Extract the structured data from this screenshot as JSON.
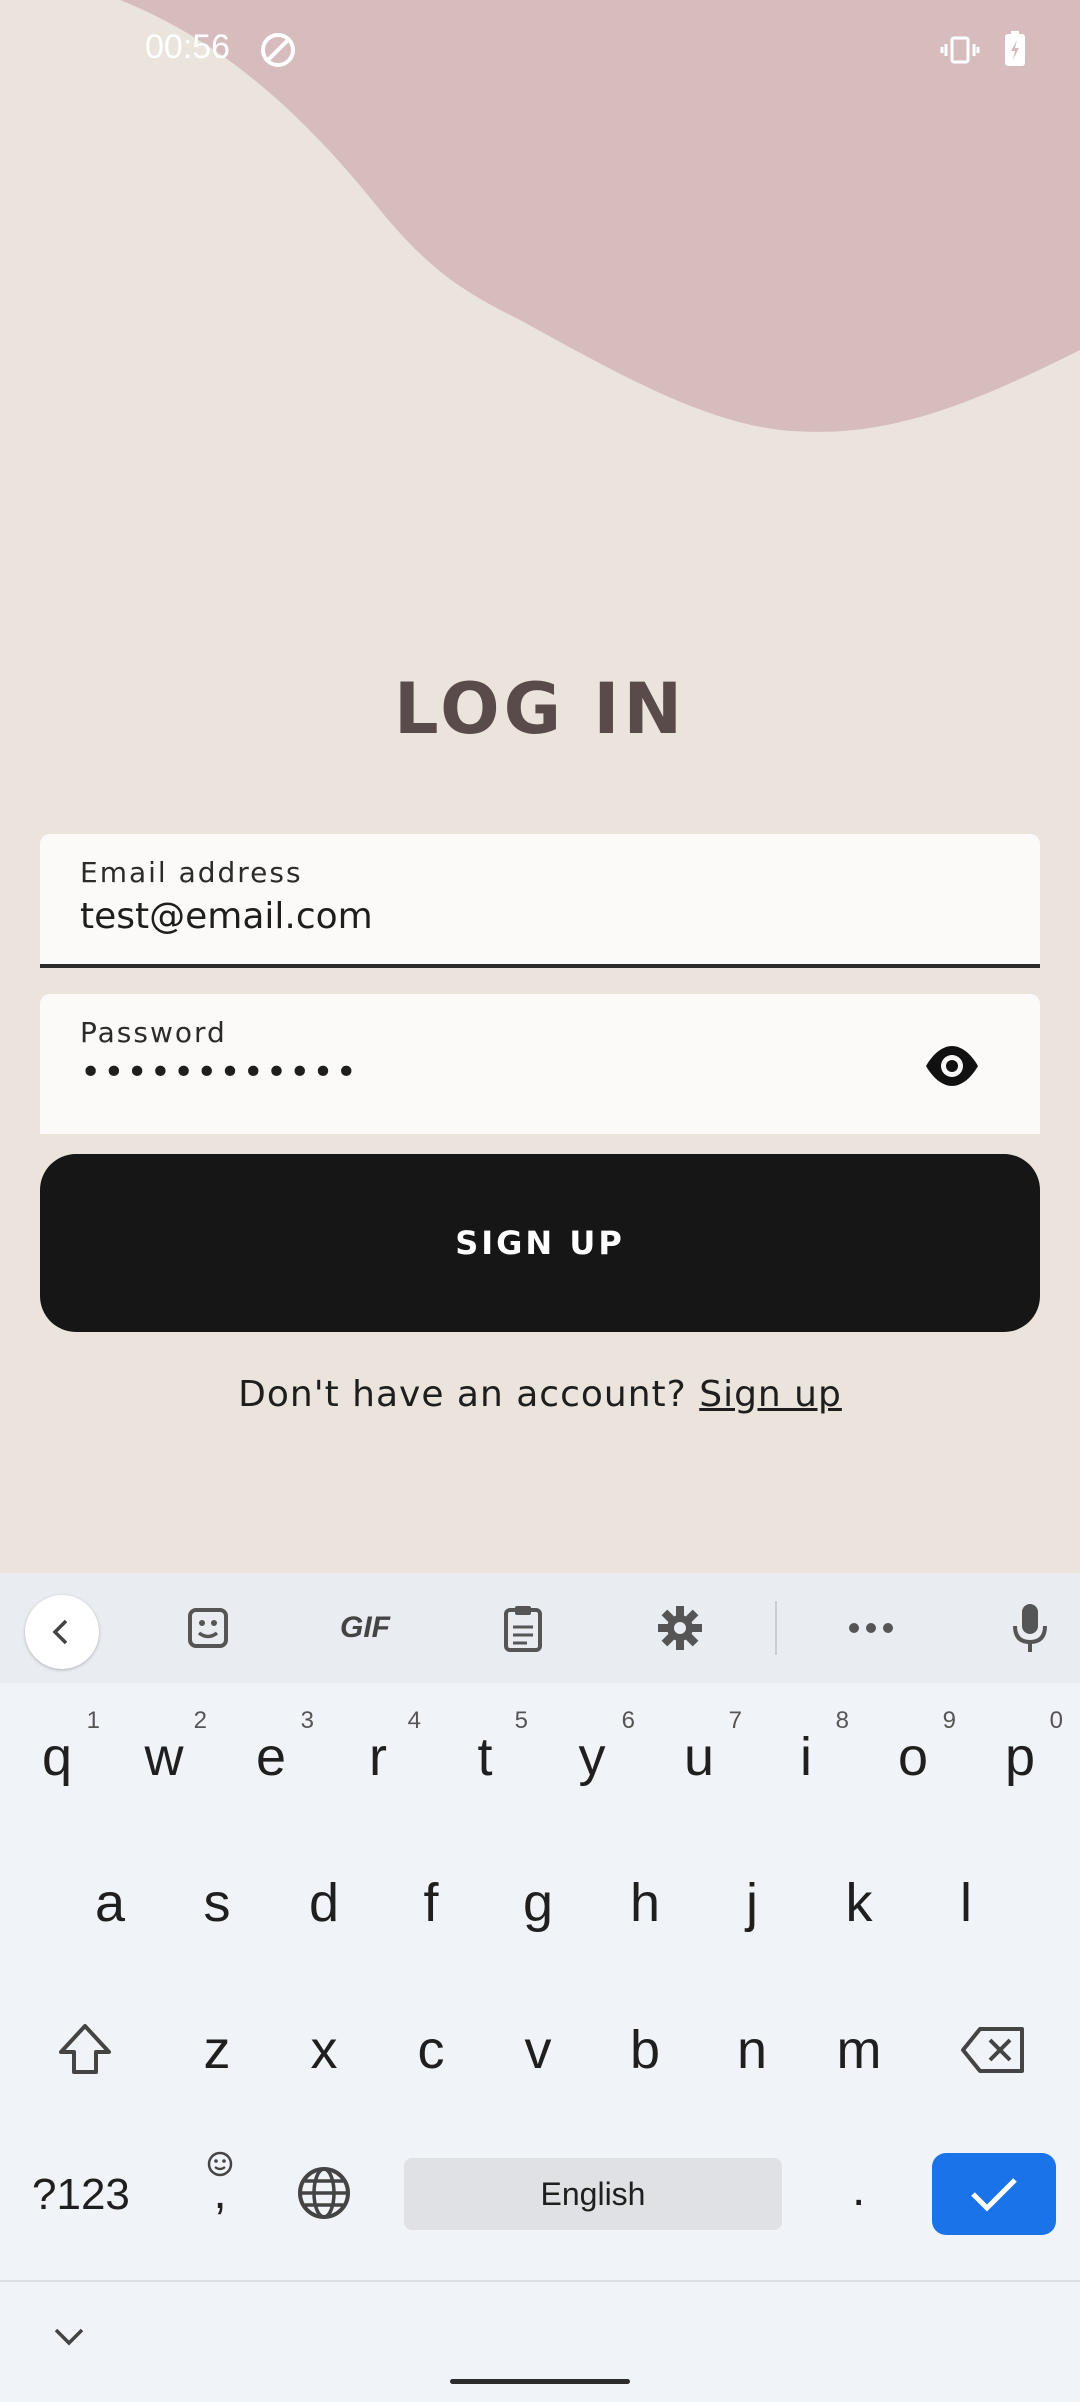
{
  "status_bar": {
    "time": "00:56"
  },
  "page": {
    "title": "LOG IN",
    "email_field": {
      "label": "Email address",
      "value": "test@email.com"
    },
    "password_field": {
      "label": "Password",
      "value": "••••••••••••"
    },
    "primary_button": "SIGN UP",
    "footer_prompt": "Don't have an account?",
    "footer_link": "Sign up"
  },
  "keyboard": {
    "toolbar": {
      "gif_label": "GIF"
    },
    "row1": [
      {
        "k": "q",
        "h": "1"
      },
      {
        "k": "w",
        "h": "2"
      },
      {
        "k": "e",
        "h": "3"
      },
      {
        "k": "r",
        "h": "4"
      },
      {
        "k": "t",
        "h": "5"
      },
      {
        "k": "y",
        "h": "6"
      },
      {
        "k": "u",
        "h": "7"
      },
      {
        "k": "i",
        "h": "8"
      },
      {
        "k": "o",
        "h": "9"
      },
      {
        "k": "p",
        "h": "0"
      }
    ],
    "row2": [
      "a",
      "s",
      "d",
      "f",
      "g",
      "h",
      "j",
      "k",
      "l"
    ],
    "row3": [
      "z",
      "x",
      "c",
      "v",
      "b",
      "n",
      "m"
    ],
    "symbols_key": "?123",
    "comma_key": ",",
    "space_label": "English",
    "period_key": "."
  },
  "colors": {
    "accent": "#1a73e8",
    "blob": "#d7bcbe",
    "background": "#ebe4dc",
    "button": "#161616"
  }
}
